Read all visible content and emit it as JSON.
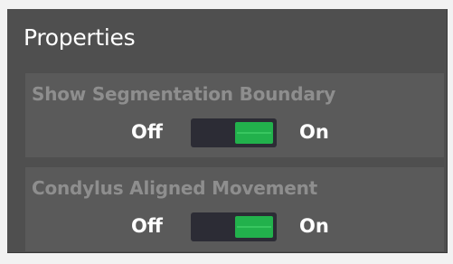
{
  "panel": {
    "title": "Properties"
  },
  "properties": [
    {
      "label": "Show Segmentation Boundary",
      "off_label": "Off",
      "on_label": "On",
      "value": "On"
    },
    {
      "label": "Condylus Aligned Movement",
      "off_label": "Off",
      "on_label": "On",
      "value": "On"
    }
  ],
  "colors": {
    "panel_bg": "#4f4f4f",
    "group_bg": "#5a5a5a",
    "toggle_track": "#2c2c35",
    "toggle_on": "#22b14c",
    "label_muted": "#8e8e8e"
  }
}
